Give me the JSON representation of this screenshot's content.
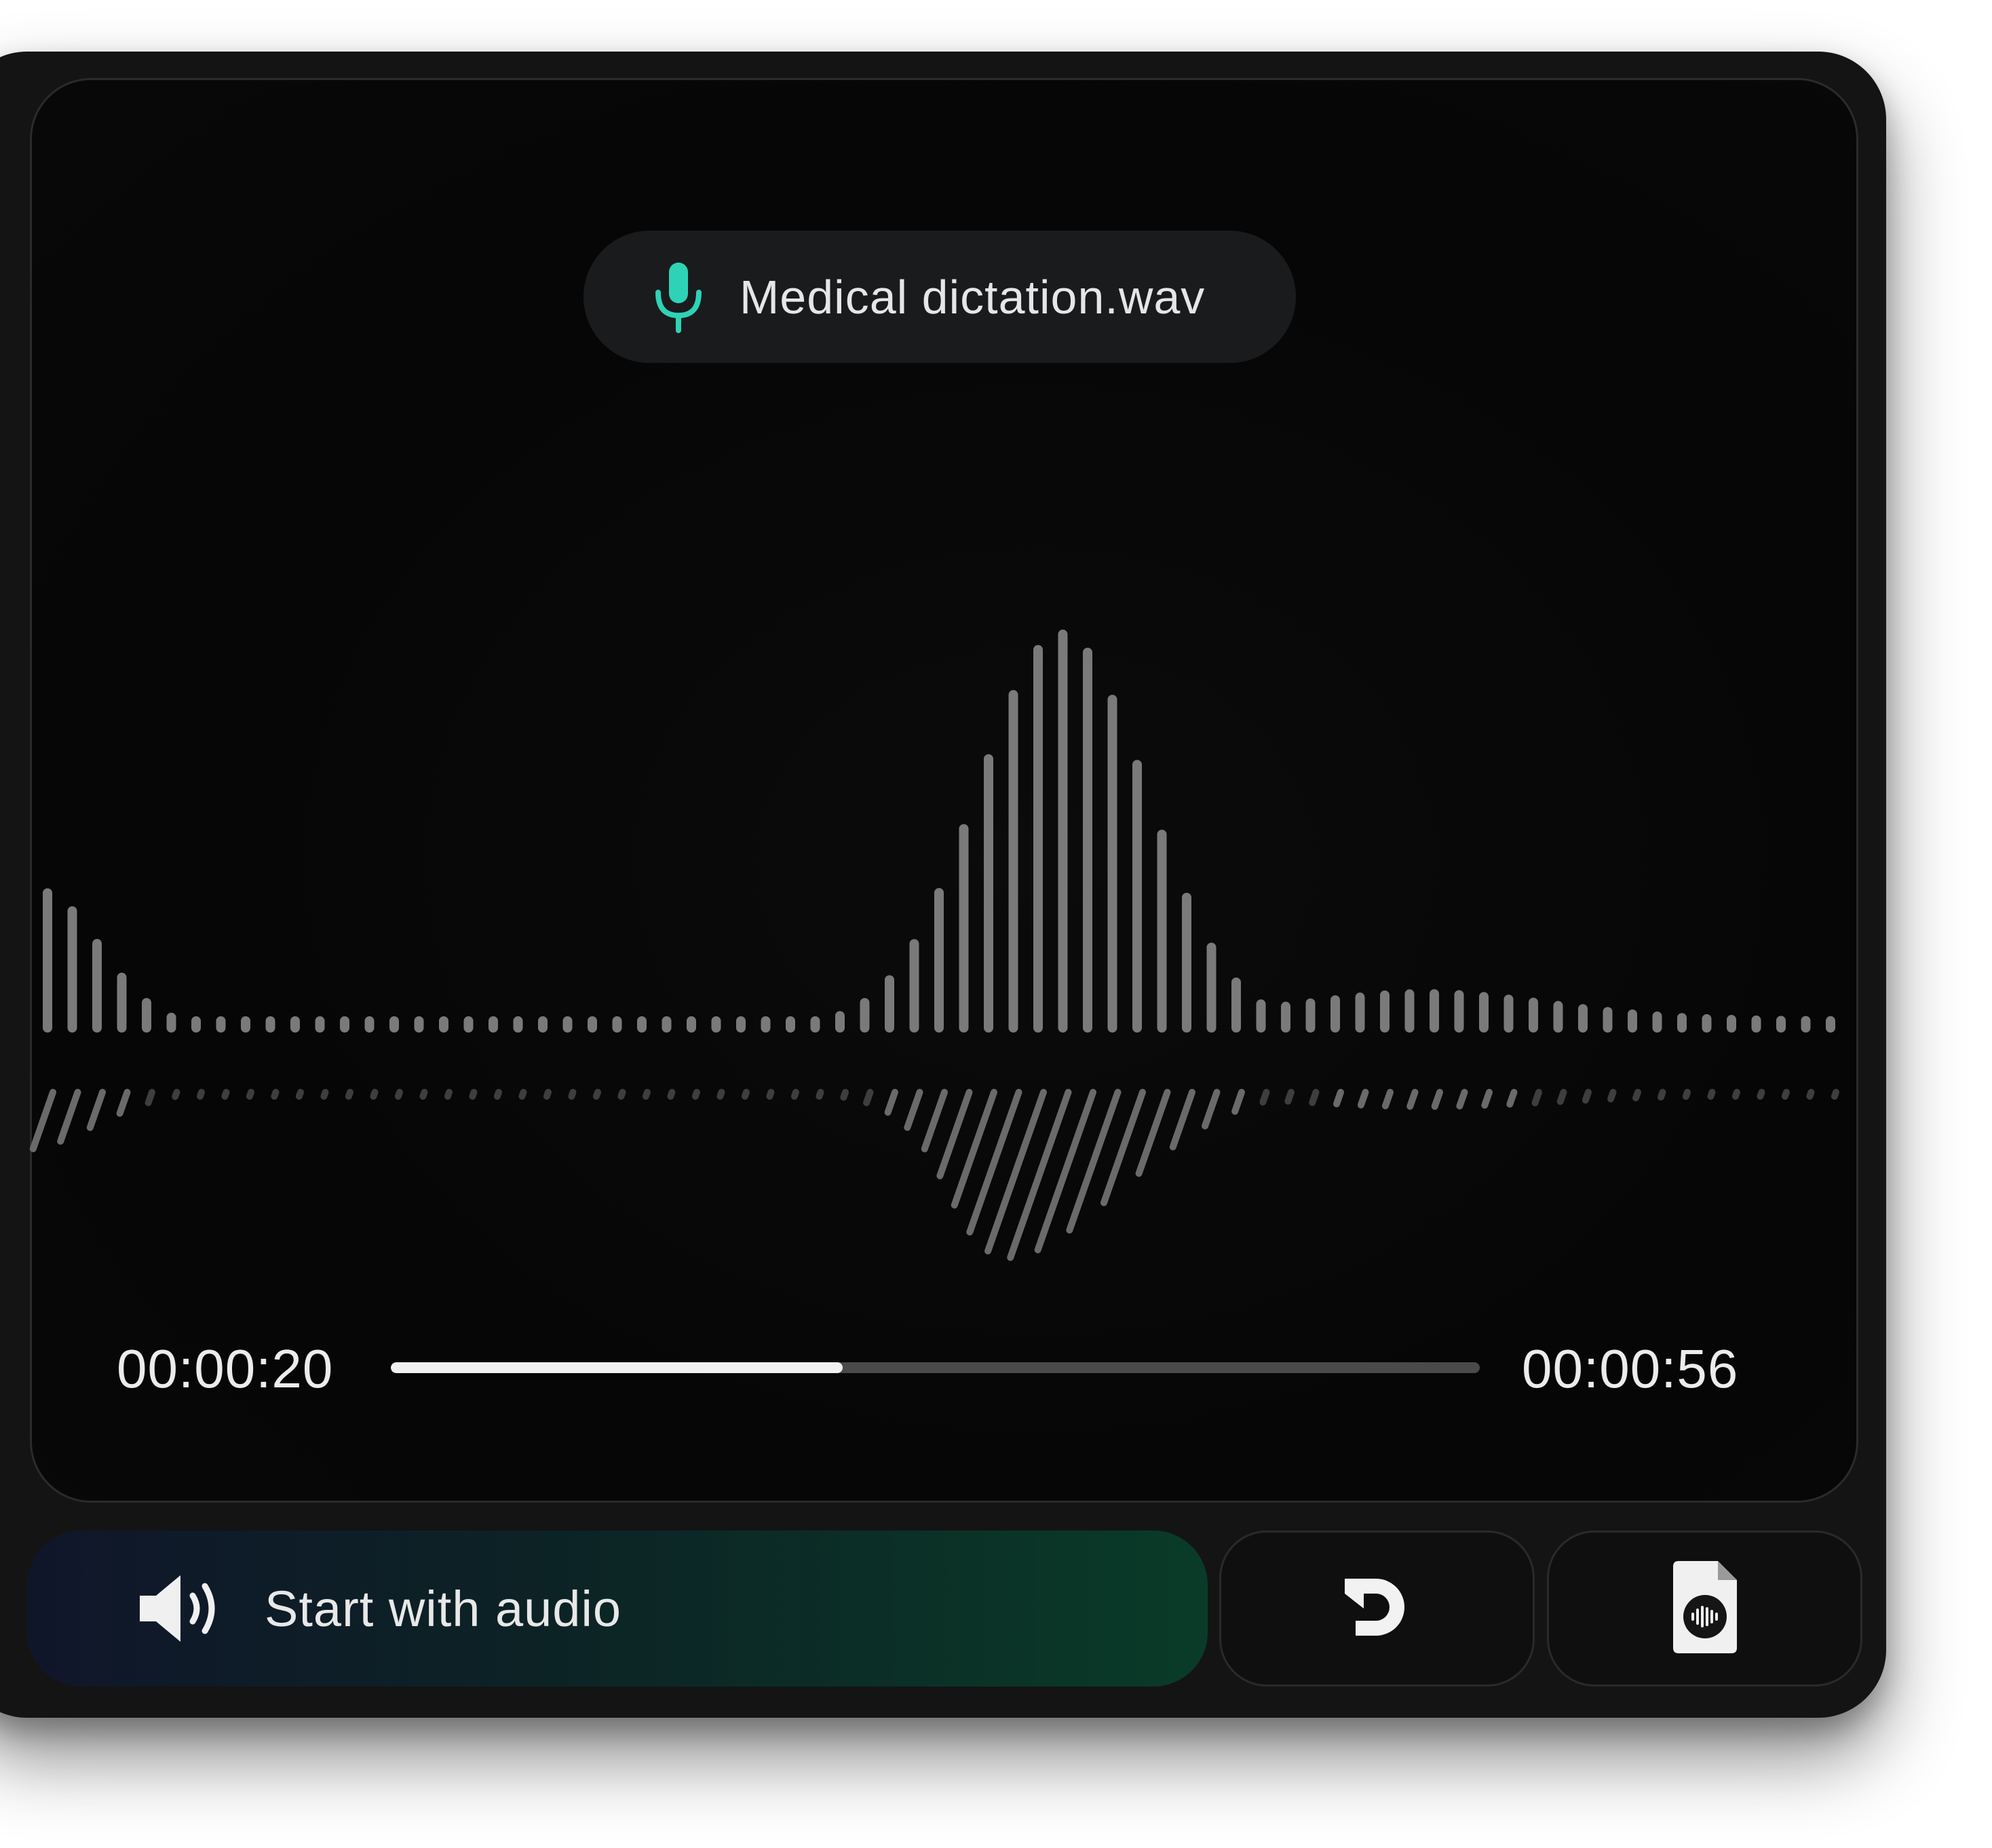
{
  "player": {
    "file_name": "Medical dictation.wav",
    "file_icon": "microphone-icon",
    "elapsed": "00:00:20",
    "total": "00:00:56",
    "progress": 0.415
  },
  "controls": {
    "start_label": "Start with audio",
    "start_icon": "speaker-icon",
    "redo_icon": "redo-icon",
    "file_icon": "audio-file-icon"
  },
  "colors": {
    "accent_mic": "#2ed3b7",
    "gradient_start": "#10162a",
    "gradient_end": "#0a3b28"
  }
}
